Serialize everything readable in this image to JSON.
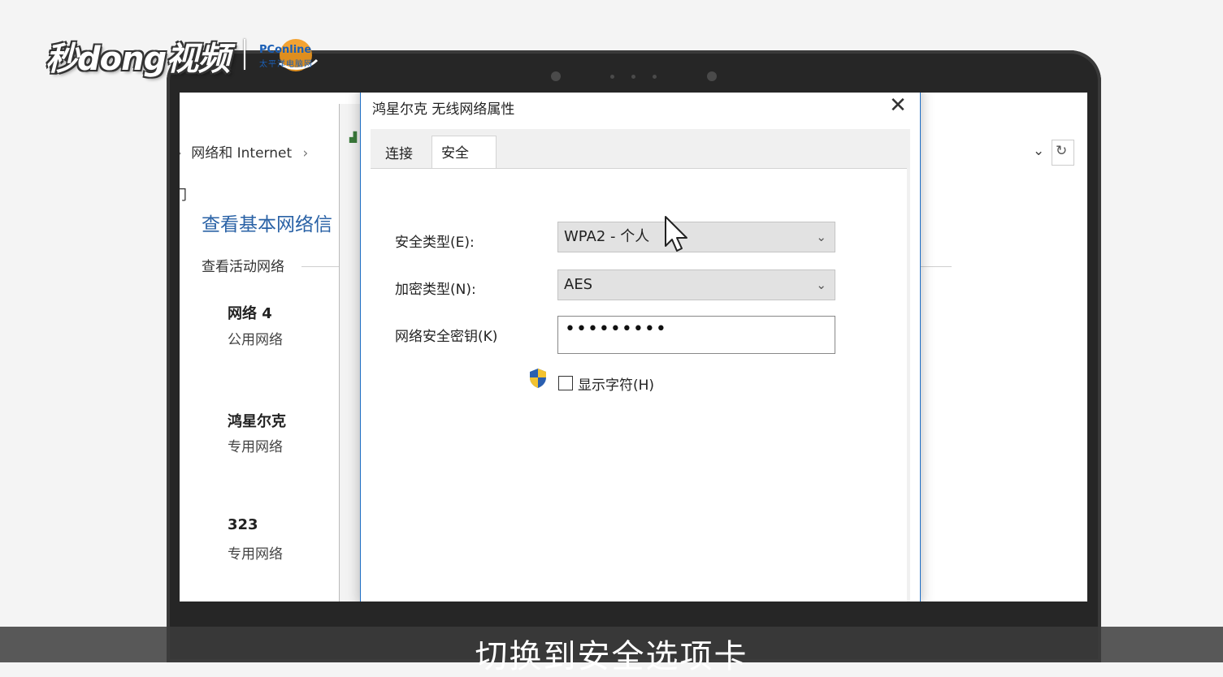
{
  "logo": {
    "main": "秒dong视频",
    "partner": "PConline",
    "partner_sub": "太平洋电脑网"
  },
  "background_window": {
    "breadcrumb_item": "网络和 Internet",
    "breadcrumb_sep": "›",
    "left_glyph": "门",
    "title": "查看基本网络信",
    "subheading": "查看活动网络",
    "right_chevron": "⌄",
    "right_refresh": "↻",
    "networks": [
      {
        "name": "网络  4",
        "type": "公用网络"
      },
      {
        "name": "鸿星尔克",
        "type": "专用网络"
      },
      {
        "name": "323",
        "type": "专用网络"
      }
    ]
  },
  "dialog": {
    "title": "鸿星尔克 无线网络属性",
    "close": "✕",
    "tabs": [
      {
        "label": "连接",
        "active": false
      },
      {
        "label": "安全",
        "active": true
      }
    ],
    "security_type": {
      "label": "安全类型(E):",
      "value": "WPA2 - 个人"
    },
    "encryption_type": {
      "label": "加密类型(N):",
      "value": "AES"
    },
    "key": {
      "label": "网络安全密钥(K)",
      "value": "•••••••••"
    },
    "show_chars": {
      "label": "显示字符(H)",
      "checked": false
    }
  },
  "subtitle": "切换到安全选项卡",
  "colors": {
    "accent": "#1f6fc5",
    "link": "#2a62a6"
  }
}
